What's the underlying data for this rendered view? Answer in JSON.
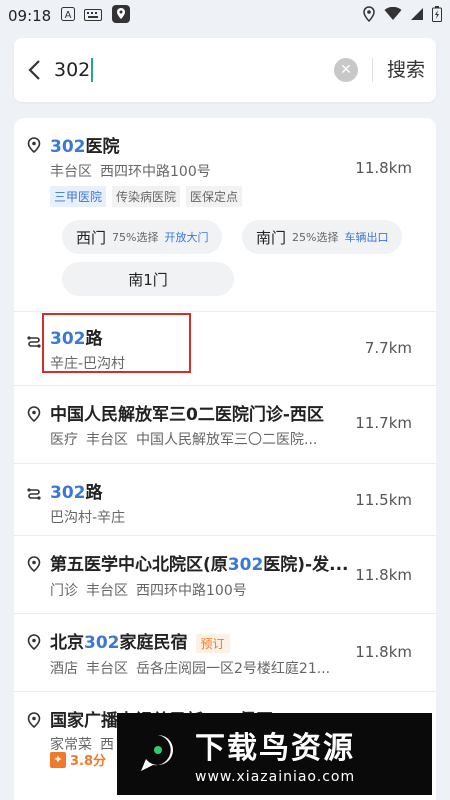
{
  "status": {
    "time": "09:18"
  },
  "search": {
    "query": "302",
    "button": "搜索"
  },
  "results": [
    {
      "title_hl": "302",
      "title_rest": "医院",
      "sub": [
        "丰台区",
        "西四环中路100号"
      ],
      "distance": "11.8km",
      "tags": [
        {
          "text": "三甲医院",
          "style": "blue"
        },
        {
          "text": "传染病医院",
          "style": "gray"
        },
        {
          "text": "医保定点",
          "style": "gray"
        }
      ],
      "gates": [
        {
          "name": "西门",
          "pct": "75%选择",
          "tag": "开放大门"
        },
        {
          "name": "南门",
          "pct": "25%选择",
          "tag": "车辆出口"
        },
        {
          "name": "南1门",
          "pct": "",
          "tag": ""
        }
      ]
    },
    {
      "title_hl": "302",
      "title_rest": "路",
      "sub": [
        "辛庄-巴沟村"
      ],
      "distance": "7.7km"
    },
    {
      "title_pre": "中国人民解放军三0二医院门诊-西区",
      "sub": [
        "医疗",
        "丰台区",
        "中国人民解放军三〇二医院..."
      ],
      "distance": "11.7km"
    },
    {
      "title_hl": "302",
      "title_rest": "路",
      "sub": [
        "巴沟村-辛庄"
      ],
      "distance": "11.5km"
    },
    {
      "title_pre": "第五医学中心北院区(原",
      "title_hl": "302",
      "title_rest": "医院)-发...",
      "sub": [
        "门诊",
        "丰台区",
        "西四环中路100号"
      ],
      "distance": "11.8km"
    },
    {
      "title_pre": "北京",
      "title_hl": "302",
      "title_rest": "家庭民宿",
      "badge": "预订",
      "sub": [
        "酒店",
        "丰台区",
        "岳各庄阅园一区2号楼红庭21..."
      ],
      "distance": "11.8km"
    },
    {
      "title_pre": "国家广播电视总局新",
      "title_hl": "302",
      "title_rest": "餐厅",
      "sub": [
        "家常菜",
        "西"
      ],
      "rating": "3.8分"
    }
  ],
  "watermark": {
    "title": "下载鸟资源",
    "url": "www.xiazainiao.com"
  },
  "colors": {
    "highlight": "#3a78d6",
    "caret": "#26a69a",
    "annotation_box": "#d0312d",
    "orange": "#f07a2a"
  }
}
